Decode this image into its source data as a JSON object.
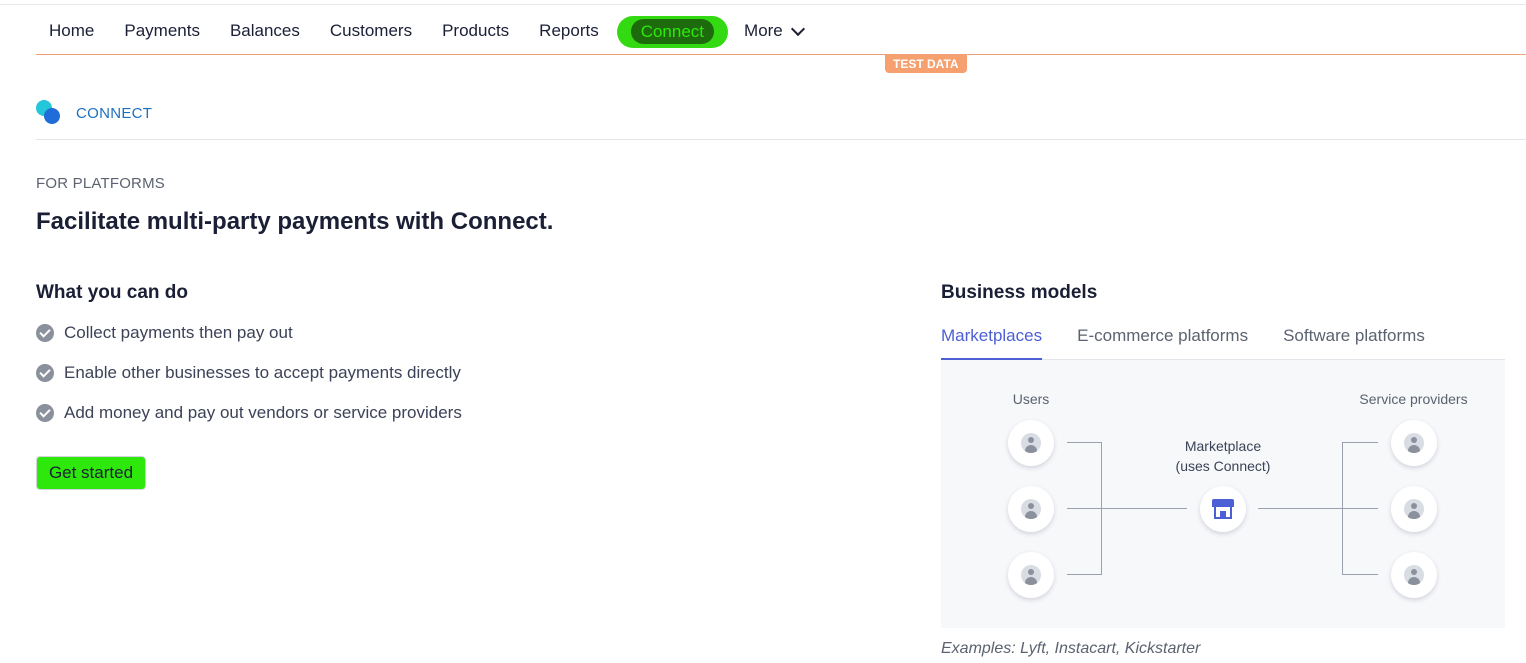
{
  "nav": {
    "items": [
      "Home",
      "Payments",
      "Balances",
      "Customers",
      "Products",
      "Reports"
    ],
    "active": "Connect",
    "more": "More"
  },
  "badge": "TEST DATA",
  "section": {
    "label": "CONNECT"
  },
  "hero": {
    "eyebrow": "FOR PLATFORMS",
    "headline": "Facilitate multi-party payments with Connect."
  },
  "what_you_can_do": {
    "title": "What you can do",
    "items": [
      "Collect payments then pay out",
      "Enable other businesses to accept payments directly",
      "Add money and pay out vendors or service providers"
    ],
    "cta": "Get started"
  },
  "business_models": {
    "title": "Business models",
    "tabs": [
      "Marketplaces",
      "E-commerce platforms",
      "Software platforms"
    ],
    "active_tab": 0,
    "diagram": {
      "left_label": "Users",
      "right_label": "Service providers",
      "center_label_line1": "Marketplace",
      "center_label_line2": "(uses Connect)"
    },
    "examples": "Examples: Lyft, Instacart, Kickstarter"
  },
  "colors": {
    "accent": "#4c5fd5",
    "highlight": "#2ee80c",
    "badge": "#f5a06e"
  }
}
